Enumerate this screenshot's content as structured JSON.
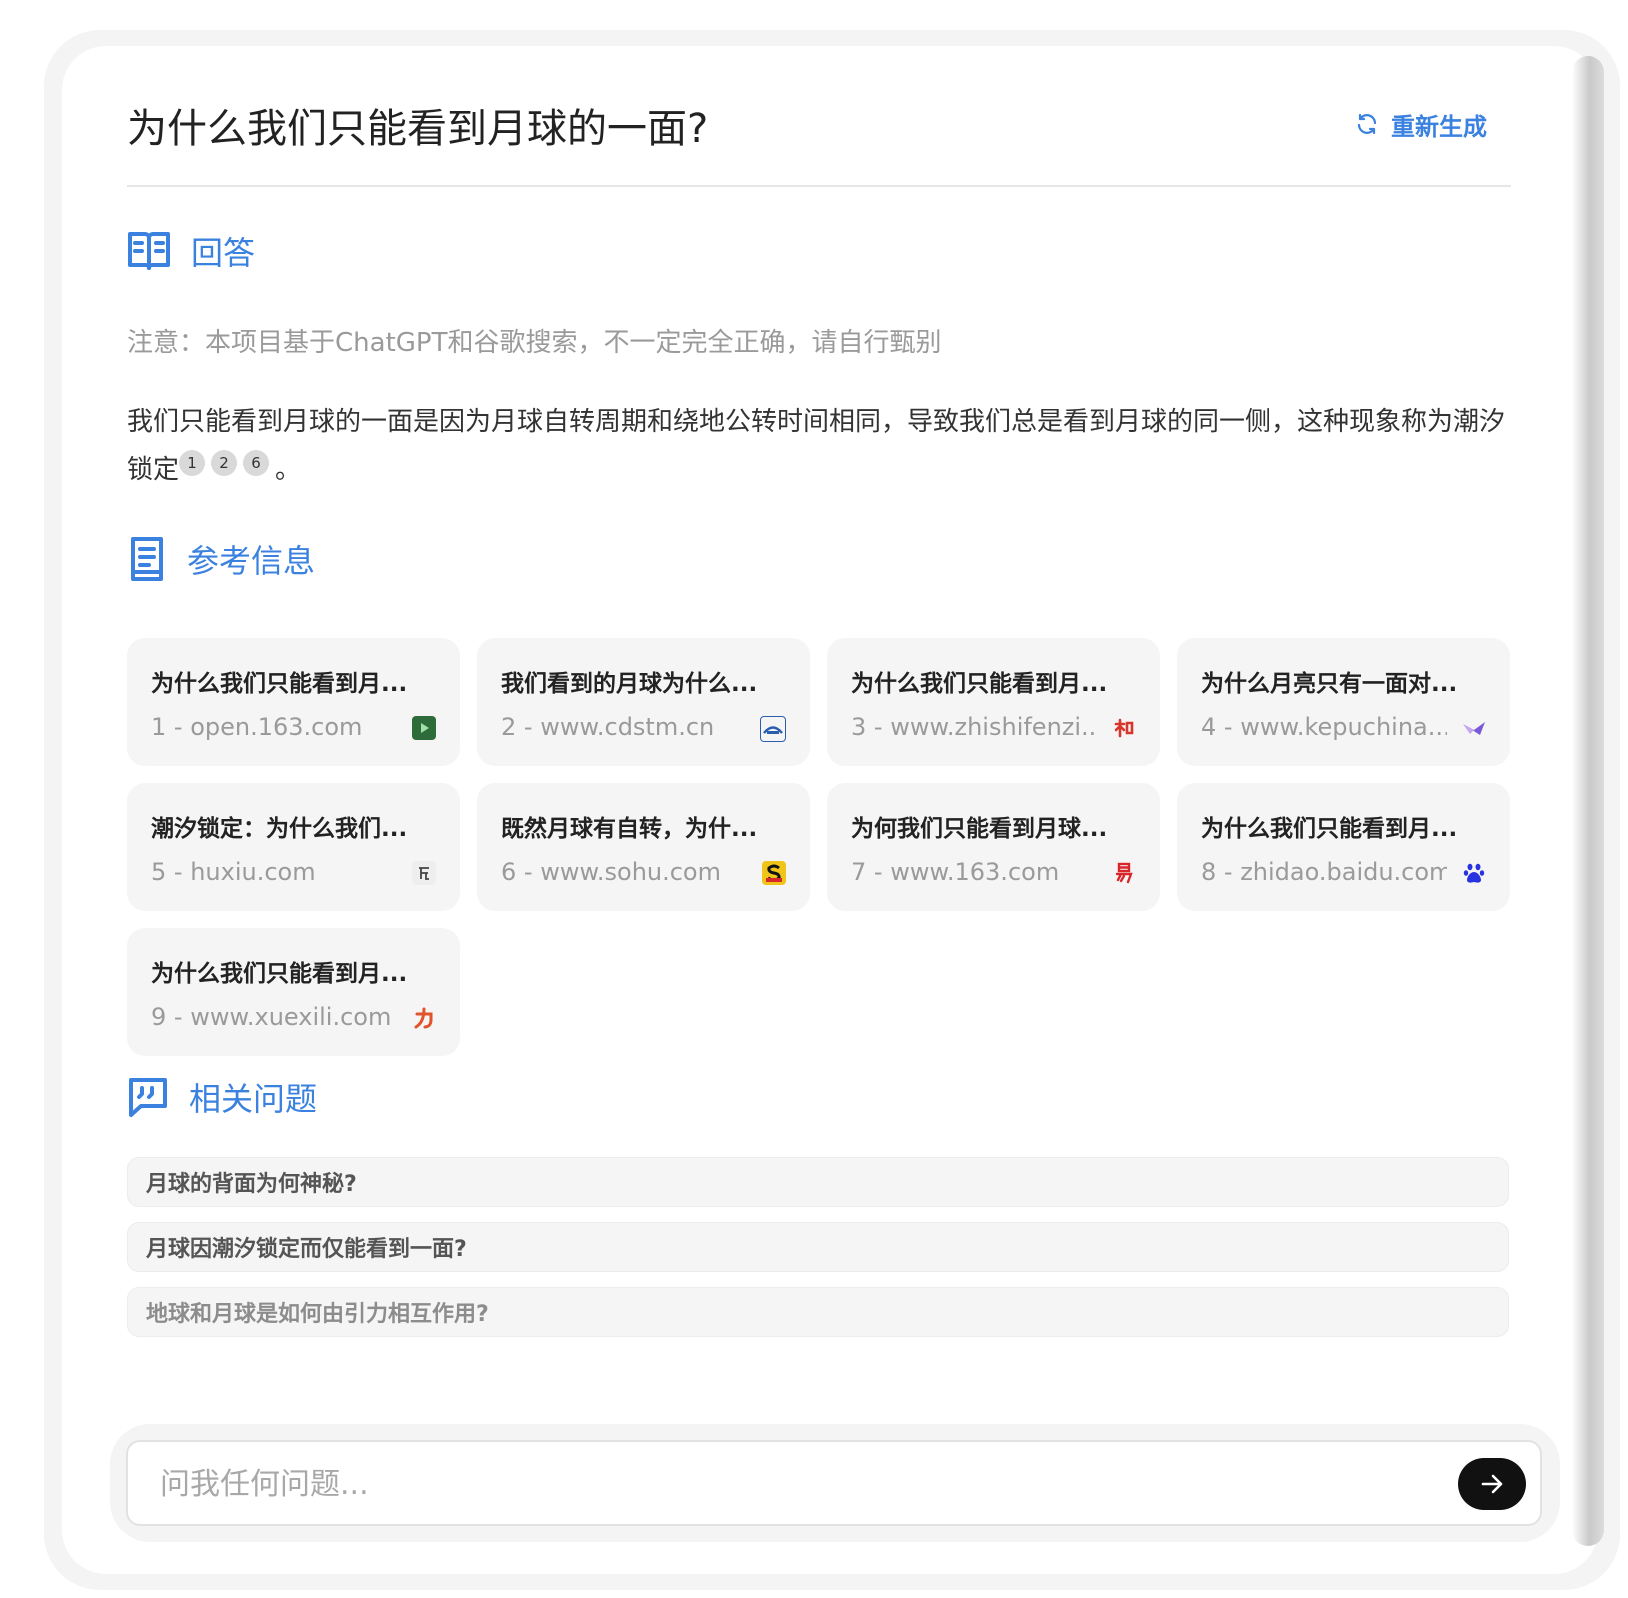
{
  "header": {
    "title": "为什么我们只能看到月球的一面?",
    "regenerate_label": "重新生成"
  },
  "answer_section": {
    "heading": "回答",
    "icon": "book-open-icon",
    "note": "注意：本项目基于ChatGPT和谷歌搜索，不一定完全正确，请自行甄别",
    "text": "我们只能看到月球的一面是因为月球自转周期和绕地公转时间相同，导致我们总是看到月球的同一侧，这种现象称为潮汐锁定",
    "citations": [
      "1",
      "2",
      "6"
    ],
    "end_punct": "。"
  },
  "references_section": {
    "heading": "参考信息",
    "icon": "document-icon",
    "items": [
      {
        "title": "为什么我们只能看到月...",
        "source": "1 - open.163.com",
        "favicon": "play-icon",
        "color": "#2e6b3a"
      },
      {
        "title": "我们看到的月球为什么...",
        "source": "2 - www.cdstm.cn",
        "favicon": "museum-icon",
        "color": "#2a5fb0"
      },
      {
        "title": "为什么我们只能看到月...",
        "source": "3 - www.zhishifenzi...",
        "favicon": "zhi-icon",
        "color": "#d9362b"
      },
      {
        "title": "为什么月亮只有一面对...",
        "source": "4 - www.kepuchina...",
        "favicon": "kepu-icon",
        "color": "#7a5ad6"
      },
      {
        "title": "潮汐锁定：为什么我们...",
        "source": "5 - huxiu.com",
        "favicon": "hu-icon",
        "color": "#444444"
      },
      {
        "title": "既然月球有自转，为什...",
        "source": "6 - www.sohu.com",
        "favicon": "sohu-icon",
        "color": "#f0c419"
      },
      {
        "title": "为何我们只能看到月球...",
        "source": "7 - www.163.com",
        "favicon": "netease-icon",
        "color": "#d9262b"
      },
      {
        "title": "为什么我们只能看到月...",
        "source": "8 - zhidao.baidu.com",
        "favicon": "baidu-paw-icon",
        "color": "#2932e1"
      },
      {
        "title": "为什么我们只能看到月...",
        "source": "9 - www.xuexili.com",
        "favicon": "xuexili-icon",
        "color": "#e0532b"
      }
    ]
  },
  "related_section": {
    "heading": "相关问题",
    "icon": "chat-quote-icon",
    "items": [
      "月球的背面为何神秘?",
      "月球因潮汐锁定而仅能看到一面?",
      "地球和月球是如何由引力相互作用?"
    ]
  },
  "composer": {
    "placeholder": "问我任何问题...",
    "send_icon": "arrow-right-icon"
  },
  "colors": {
    "accent": "#3b82e0",
    "card_bg": "#f5f5f5"
  }
}
